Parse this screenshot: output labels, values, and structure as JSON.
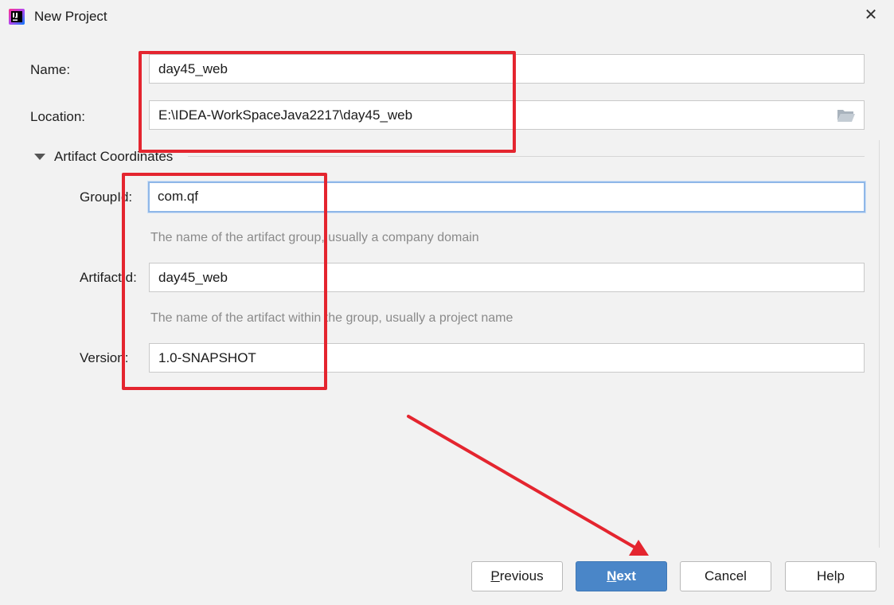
{
  "window": {
    "title": "New Project",
    "close_glyph": "✕"
  },
  "form": {
    "name": {
      "label": "Name:",
      "value": "day45_web"
    },
    "location": {
      "label": "Location:",
      "value": "E:\\IDEA-WorkSpaceJava2217\\day45_web"
    },
    "artifact_section": {
      "label": "Artifact Coordinates",
      "expanded": true
    },
    "group_id": {
      "label": "GroupId:",
      "value": "com.qf",
      "hint": "The name of the artifact group, usually a company domain"
    },
    "artifact_id": {
      "label": "ArtifactId:",
      "value": "day45_web",
      "hint": "The name of the artifact within the group, usually a project name"
    },
    "version": {
      "label": "Version:",
      "value": "1.0-SNAPSHOT"
    }
  },
  "buttons": {
    "previous": {
      "mnemonic": "P",
      "rest": "revious"
    },
    "next": {
      "mnemonic": "N",
      "rest": "ext"
    },
    "cancel": "Cancel",
    "help": "Help"
  },
  "icons": {
    "app": "intellij-idea-icon",
    "browse": "folder-icon",
    "collapse": "triangle-down-icon",
    "close": "close-icon"
  },
  "colors": {
    "background": "#f2f2f2",
    "primary_button": "#4a86c8",
    "focus_border": "#8fb7e8",
    "annotation": "#e4252f"
  }
}
